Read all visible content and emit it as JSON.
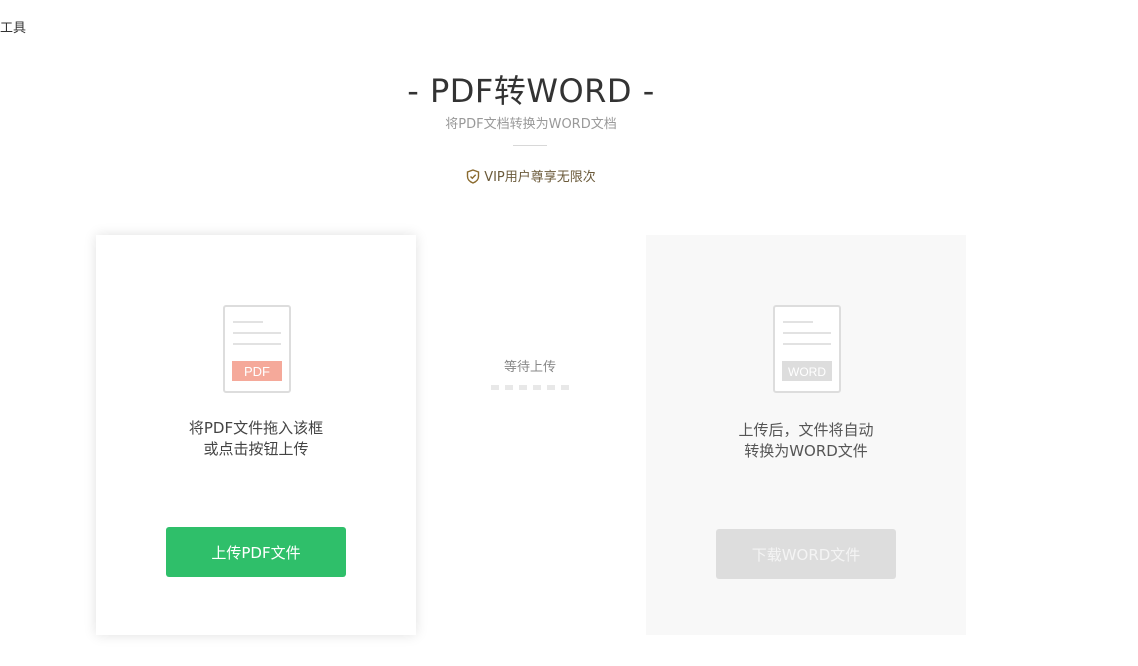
{
  "top_label": "工具",
  "header": {
    "title": "- PDF转WORD -",
    "subtitle": "将PDF文档转换为WORD文档",
    "vip_text": "VIP用户尊享无限次",
    "vip_icon": "shield-check-icon"
  },
  "upload_card": {
    "badge": "PDF",
    "badge_color": "#f5a99a",
    "line1": "将PDF文件拖入该框",
    "line2": "或点击按钮上传",
    "button_label": "上传PDF文件",
    "button_color": "#2fbf6a"
  },
  "status": {
    "label": "等待上传"
  },
  "download_card": {
    "badge": "WORD",
    "line1": "上传后，文件将自动",
    "line2": "转换为WORD文件",
    "button_label": "下载WORD文件",
    "button_color": "#dddddd"
  }
}
